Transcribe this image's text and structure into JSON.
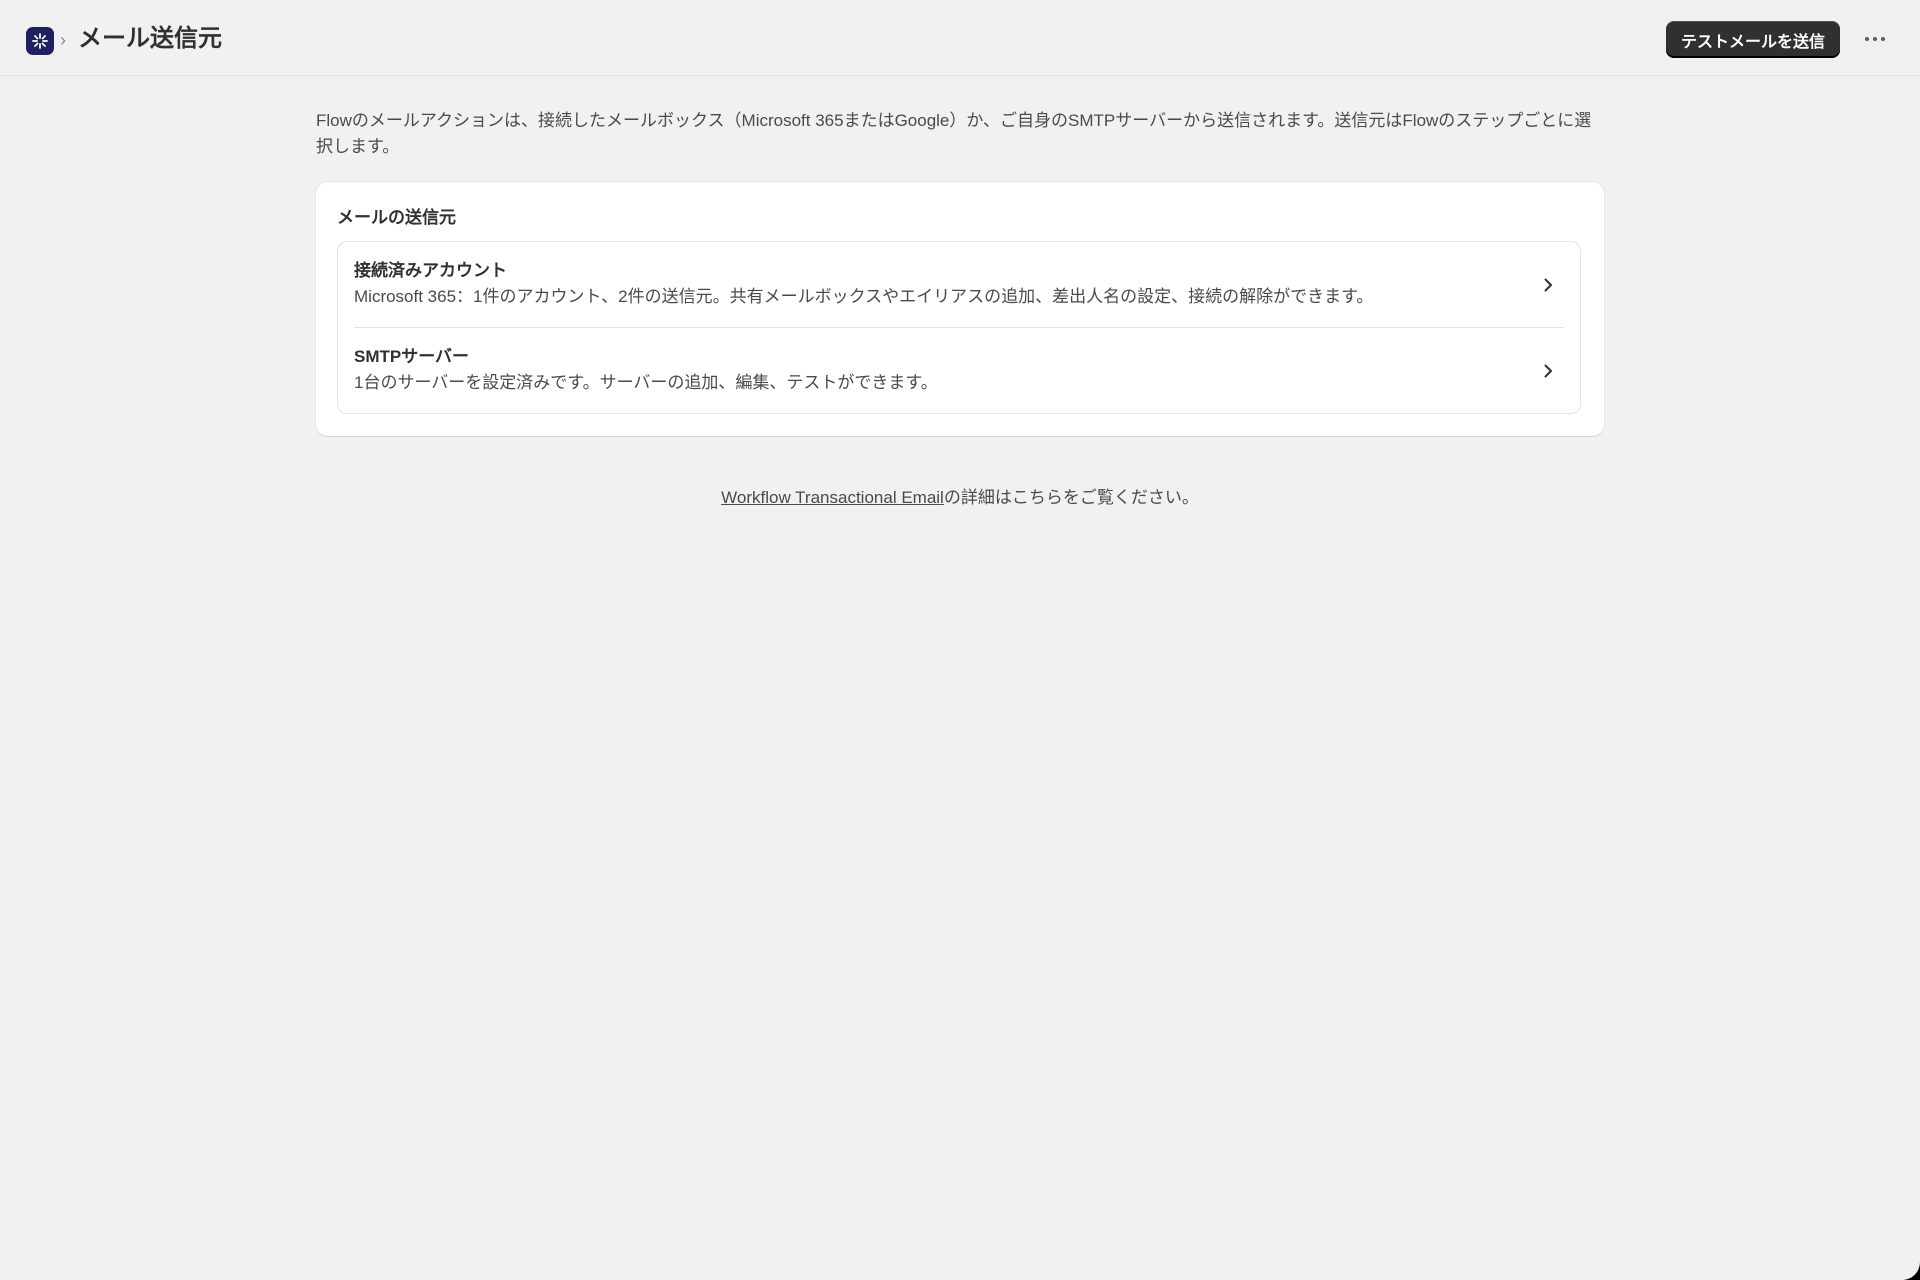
{
  "header": {
    "app_icon": "flow-app-icon",
    "breadcrumb_separator": "›",
    "title": "メール送信元",
    "primary_button_label": "テストメールを送信",
    "more_icon": "more-horizontal-icon"
  },
  "intro": {
    "text": "Flowのメールアクションは、接続したメールボックス（Microsoft 365またはGoogle）か、ご自身のSMTPサーバーから送信されます。送信元はFlowのステップごとに選択します。"
  },
  "card": {
    "title": "メールの送信元",
    "items": [
      {
        "title": "接続済みアカウント",
        "description": "Microsoft 365：1件のアカウント、2件の送信元。共有メールボックスやエイリアスの追加、差出人名の設定、接続の解除ができます。",
        "icon": "chevron-right-icon"
      },
      {
        "title": "SMTPサーバー",
        "description": "1台のサーバーを設定済みです。サーバーの追加、編集、テストができます。",
        "icon": "chevron-right-icon"
      }
    ]
  },
  "footer": {
    "link_text": "Workflow Transactional Email",
    "suffix_text": "の詳細はこちらをご覧ください。"
  },
  "colors": {
    "background": "#f1f1f1",
    "primary_button": "#303030",
    "app_icon_bg": "#1c2260",
    "card_bg": "#ffffff"
  }
}
